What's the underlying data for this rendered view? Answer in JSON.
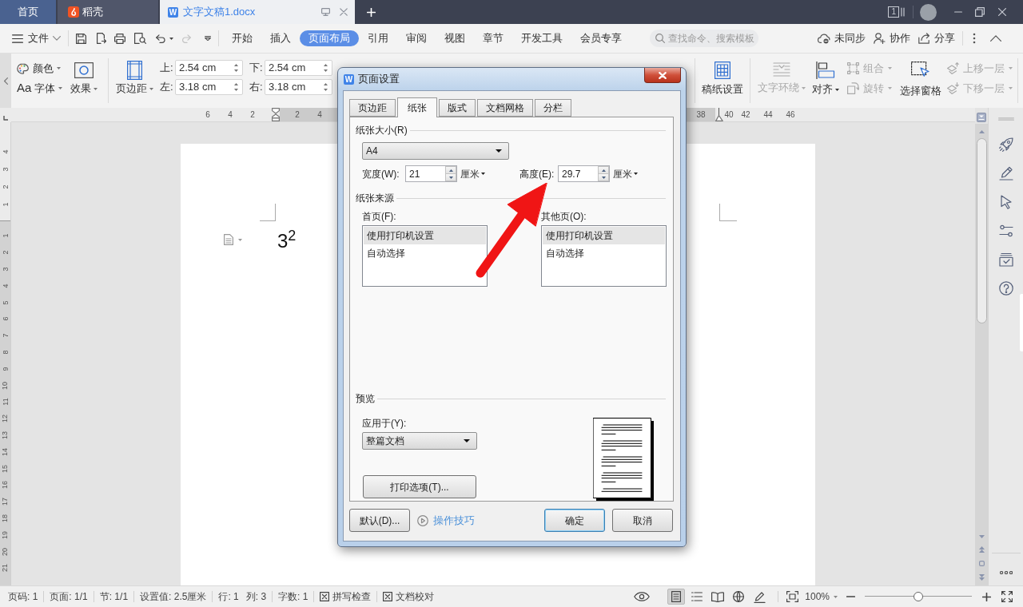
{
  "title_bar": {
    "tabs": [
      {
        "kind": "home",
        "label": "首页",
        "selected": false
      },
      {
        "kind": "app",
        "label": "稻壳",
        "selected": false
      },
      {
        "kind": "document",
        "logo": "W",
        "label": "文字文稿1.docx",
        "selected": true
      }
    ],
    "window_count": "1"
  },
  "menu_bar": {
    "file_menu": "文件",
    "quick_access": [
      {
        "disabled": false
      },
      {
        "disabled": false
      },
      {
        "disabled": false
      },
      {
        "disabled": false
      },
      {
        "disabled": false
      },
      {
        "disabled": true
      }
    ],
    "tabs": [
      {
        "label": "开始",
        "selected": false
      },
      {
        "label": "插入",
        "selected": false
      },
      {
        "label": "页面布局",
        "selected": true
      },
      {
        "label": "引用",
        "selected": false
      },
      {
        "label": "审阅",
        "selected": false
      },
      {
        "label": "视图",
        "selected": false
      },
      {
        "label": "章节",
        "selected": false
      },
      {
        "label": "开发工具",
        "selected": false
      },
      {
        "label": "会员专享",
        "selected": false
      }
    ],
    "search": {
      "placeholder": "查找命令、搜索模板"
    },
    "actions": [
      {
        "label": "未同步"
      },
      {
        "label": "协作"
      },
      {
        "label": "分享"
      }
    ]
  },
  "ribbon": {
    "theme": [
      {
        "label": "颜色"
      },
      {
        "glyph": "Aa",
        "label": "字体"
      }
    ],
    "effects": "效果",
    "margins_button": "页边距",
    "margins": [
      {
        "label": "上:",
        "value": "2.54 cm"
      },
      {
        "label": "下:",
        "value": "2.54 cm"
      },
      {
        "label": "左:",
        "value": "3.18 cm"
      },
      {
        "label": "右:",
        "value": "3.18 cm"
      }
    ],
    "tools": [
      {
        "kind": "large",
        "label": "稿纸设置",
        "disabled": false,
        "dropdown": false
      },
      {
        "kind": "large",
        "label": "文字环绕",
        "disabled": true,
        "dropdown": true
      },
      {
        "kind": "large",
        "label": "对齐",
        "disabled": false,
        "dropdown": true
      },
      {
        "kind": "stack",
        "items": [
          {
            "label": "组合",
            "disabled": true
          },
          {
            "label": "旋转",
            "disabled": true
          }
        ]
      },
      {
        "kind": "large",
        "label": "选择窗格",
        "disabled": false,
        "dropdown": false
      },
      {
        "kind": "stack",
        "items": [
          {
            "label": "上移一层",
            "disabled": true
          },
          {
            "label": "下移一层",
            "disabled": true
          }
        ]
      }
    ]
  },
  "horizontal_ruler": {
    "before_indent": [
      "6",
      "4",
      "2"
    ],
    "after_indent": [
      "2",
      "4"
    ],
    "before_right_indent": [
      "38"
    ],
    "after_right_indent": [
      "40",
      "42",
      "44",
      "46"
    ]
  },
  "vertical_ruler": {
    "above_page": [
      "4",
      "3",
      "2",
      "1"
    ],
    "on_page": [
      "1",
      "2",
      "3",
      "4",
      "5",
      "6",
      "7",
      "8",
      "9",
      "10",
      "11",
      "12",
      "13",
      "14",
      "15",
      "16",
      "17",
      "18",
      "19",
      "20",
      "21"
    ]
  },
  "document": {
    "text": "3$^{2}$"
  },
  "dialog": {
    "logo": "W",
    "title": "页面设置",
    "tabs": [
      {
        "label": "页边距",
        "selected": false
      },
      {
        "label": "纸张",
        "selected": true
      },
      {
        "label": "版式",
        "selected": false
      },
      {
        "label": "文档网格",
        "selected": false
      },
      {
        "label": "分栏",
        "selected": false
      }
    ],
    "paper_size": {
      "heading": "纸张大小(R)",
      "size": "A4",
      "width": {
        "label": "宽度(W):",
        "value": "21",
        "unit": "厘米"
      },
      "height": {
        "label": "高度(E):",
        "value": "29.7",
        "unit": "厘米"
      }
    },
    "paper_source": {
      "heading": "纸张来源",
      "lists": [
        {
          "label": "首页(F):",
          "options": [
            {
              "label": "使用打印机设置",
              "selected": true
            },
            {
              "label": "自动选择",
              "selected": false
            }
          ]
        },
        {
          "label": "其他页(O):",
          "options": [
            {
              "label": "使用打印机设置",
              "selected": true
            },
            {
              "label": "自动选择",
              "selected": false
            }
          ]
        }
      ]
    },
    "preview": {
      "heading": "预览",
      "apply_to_label": "应用于(Y):",
      "apply_to": "整篇文档",
      "print_options_button": "打印选项(T)..."
    },
    "footer": {
      "default_button": "默认(D)...",
      "tips_link": "操作技巧",
      "buttons": [
        {
          "label": "确定",
          "focused": true
        },
        {
          "label": "取消",
          "focused": false
        }
      ]
    }
  },
  "status_bar": {
    "fields": [
      [
        "页码: 1"
      ],
      [
        "页面: 1/1"
      ],
      [
        "节: 1/1"
      ],
      [
        "设置值: 2.5厘米"
      ],
      [
        "行: 1",
        "列: 3"
      ],
      [
        "字数: 1"
      ]
    ],
    "checks": [
      "拼写检查",
      "文档校对"
    ],
    "views": [
      {
        "selected": true
      },
      {
        "selected": false
      },
      {
        "selected": false
      },
      {
        "selected": false
      },
      {
        "selected": false
      }
    ],
    "zoom": {
      "value": "100%",
      "level": 0.5
    }
  }
}
